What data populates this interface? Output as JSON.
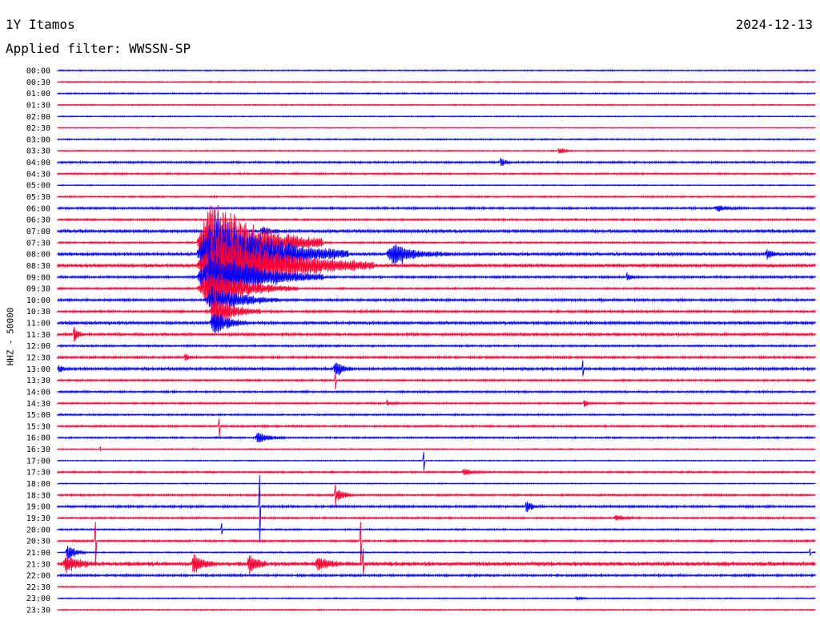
{
  "header": {
    "station": "1Y Itamos",
    "date": "2024-12-13",
    "filter": "Applied filter: WWSSN-SP"
  },
  "chart_data": {
    "type": "line",
    "title": "1Y Itamos",
    "ylabel": "HHZ - 50000",
    "row_labels": [
      "00:00",
      "00:30",
      "01:00",
      "01:30",
      "02:00",
      "02:30",
      "03:00",
      "03:30",
      "04:00",
      "04:30",
      "05:00",
      "05:30",
      "06:00",
      "06:30",
      "07:00",
      "07:30",
      "08:00",
      "08:30",
      "09:00",
      "09:30",
      "10:00",
      "10:30",
      "11:00",
      "11:30",
      "12:00",
      "12:30",
      "13:00",
      "13:30",
      "14:00",
      "14:30",
      "15:00",
      "15:30",
      "16:00",
      "16:30",
      "17:00",
      "17:30",
      "18:00",
      "18:30",
      "19:00",
      "19:30",
      "20:00",
      "20:30",
      "21:00",
      "21:30",
      "22:00",
      "22:30",
      "23:00",
      "23:30"
    ],
    "row_minutes": 30,
    "colors": [
      "#0000ff",
      "#ff0033"
    ],
    "noise": [
      0.6,
      0.6,
      0.7,
      0.6,
      0.5,
      0.4,
      0.7,
      0.6,
      1.0,
      0.9,
      0.5,
      0.8,
      1.1,
      1.0,
      1.6,
      0.9,
      1.6,
      1.8,
      1.2,
      1.0,
      1.3,
      1.2,
      1.5,
      1.4,
      1.0,
      1.2,
      1.5,
      1.0,
      1.0,
      0.9,
      0.9,
      1.0,
      0.9,
      0.6,
      0.5,
      0.9,
      0.5,
      1.0,
      1.2,
      1.0,
      0.8,
      1.0,
      0.7,
      2.2,
      1.2,
      0.6,
      0.6,
      0.6
    ],
    "events": [
      {
        "row": 15,
        "min": 5.5,
        "amp": 70,
        "dur": 5,
        "up": 0.6
      },
      {
        "row": 16,
        "min": 5.5,
        "amp": 60,
        "dur": 6,
        "up": 0.6
      },
      {
        "row": 17,
        "min": 5.5,
        "amp": 55,
        "dur": 7,
        "up": 0.5
      },
      {
        "row": 18,
        "min": 5.5,
        "amp": 45,
        "dur": 5,
        "up": 0.5
      },
      {
        "row": 19,
        "min": 5.5,
        "amp": 30,
        "dur": 4,
        "up": 0.4
      },
      {
        "row": 20,
        "min": 5.8,
        "amp": 22,
        "dur": 3,
        "up": 0.4
      },
      {
        "row": 21,
        "min": 6.0,
        "amp": 25,
        "dur": 2,
        "up": 0.4
      },
      {
        "row": 22,
        "min": 6.0,
        "amp": 20,
        "dur": 1.5,
        "up": 0.4
      },
      {
        "row": 16,
        "min": 13.0,
        "amp": 16,
        "dur": 2.5,
        "up": 0.4
      },
      {
        "row": 14,
        "min": 8.0,
        "amp": 6,
        "dur": 1.0,
        "up": 0.4
      },
      {
        "row": 16,
        "min": 7.5,
        "amp": 7,
        "dur": 2.5,
        "up": 0.4
      },
      {
        "row": 23,
        "min": 0.6,
        "amp": 12,
        "dur": 0.5,
        "up": 0.3
      },
      {
        "row": 26,
        "min": 0.0,
        "amp": 5,
        "dur": 0.5,
        "up": 0.3
      },
      {
        "row": 26,
        "min": 10.9,
        "amp": 13,
        "dur": 0.8,
        "up": 0.3
      },
      {
        "row": 32,
        "min": 7.8,
        "amp": 9,
        "dur": 1.2,
        "up": 0.4
      },
      {
        "row": 35,
        "min": 16.0,
        "amp": 5,
        "dur": 1.0,
        "up": 0.4
      },
      {
        "row": 37,
        "min": 11.0,
        "amp": 11,
        "dur": 0.7,
        "up": 0.3
      },
      {
        "row": 38,
        "min": 18.5,
        "amp": 9,
        "dur": 0.6,
        "up": 0.3
      },
      {
        "row": 42,
        "min": 0.3,
        "amp": 16,
        "dur": 0.8,
        "up": 0.3
      },
      {
        "row": 43,
        "min": 0.2,
        "amp": 14,
        "dur": 1.2,
        "up": 0.3
      },
      {
        "row": 43,
        "min": 5.3,
        "amp": 14,
        "dur": 1.0,
        "up": 0.3
      },
      {
        "row": 43,
        "min": 7.5,
        "amp": 14,
        "dur": 0.8,
        "up": 0.3
      },
      {
        "row": 43,
        "min": 10.2,
        "amp": 12,
        "dur": 1.0,
        "up": 0.3
      },
      {
        "row": 8,
        "min": 17.5,
        "amp": 8,
        "dur": 0.5,
        "up": 0.3
      },
      {
        "row": 7,
        "min": 19.8,
        "amp": 6,
        "dur": 0.6,
        "up": 0.3
      },
      {
        "row": 12,
        "min": 26.0,
        "amp": 4,
        "dur": 1.2,
        "up": 0.3
      },
      {
        "row": 16,
        "min": 28.0,
        "amp": 6,
        "dur": 0.8,
        "up": 0.3
      },
      {
        "row": 18,
        "min": 22.5,
        "amp": 5,
        "dur": 0.5,
        "up": 0.3
      },
      {
        "row": 25,
        "min": 5.0,
        "amp": 5,
        "dur": 0.5,
        "up": 0.3
      },
      {
        "row": 29,
        "min": 13.0,
        "amp": 5,
        "dur": 0.5,
        "up": 0.3
      },
      {
        "row": 29,
        "min": 20.8,
        "amp": 6,
        "dur": 0.4,
        "up": 0.3
      },
      {
        "row": 39,
        "min": 22.0,
        "amp": 4,
        "dur": 1.0,
        "up": 0.3
      },
      {
        "row": 46,
        "min": 20.5,
        "amp": 3,
        "dur": 0.5,
        "up": 0.3
      }
    ],
    "spikes": [
      {
        "row": 33,
        "min": 1.7,
        "amp": 3,
        "dur": 1.0
      },
      {
        "row": 34,
        "min": 14.5,
        "amp": 14
      },
      {
        "row": 31,
        "min": 6.4,
        "amp": 14
      },
      {
        "row": 37,
        "min": 11.0,
        "amp": 14
      },
      {
        "row": 26,
        "min": 20.8,
        "amp": 12
      },
      {
        "row": 27,
        "min": 11.0,
        "amp": 12
      },
      {
        "row": 38,
        "min": 8.0,
        "amp": 60
      },
      {
        "row": 41,
        "min": 12.0,
        "amp": 30
      },
      {
        "row": 41,
        "min": 1.5,
        "amp": 35
      },
      {
        "row": 43,
        "min": 12.1,
        "amp": 20
      },
      {
        "row": 40,
        "min": 6.5,
        "amp": 8
      },
      {
        "row": 42,
        "min": 29.8,
        "amp": 6
      }
    ]
  }
}
